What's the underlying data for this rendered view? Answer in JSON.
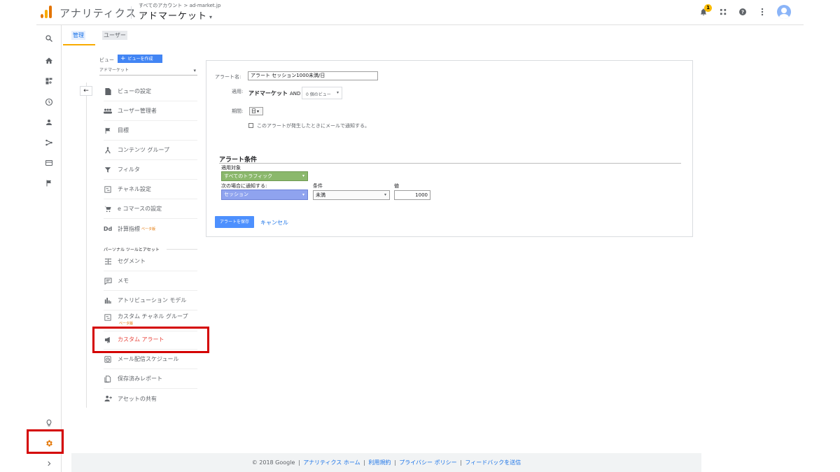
{
  "header": {
    "app_name": "アナリティクス",
    "breadcrumb_all": "すべてのアカウント",
    "breadcrumb_sep": ">",
    "breadcrumb_account": "ad-market.jp",
    "property_name": "アドマーケット",
    "notification_count": "1"
  },
  "tabs": [
    {
      "label": "管理"
    },
    {
      "label": "ユーザー"
    }
  ],
  "nav": {
    "view_label": "ビュー",
    "create_view_label": "ビューを作成",
    "selected_view": "アドマーケット",
    "items": [
      {
        "label": "ビューの設定",
        "icon": "document-icon"
      },
      {
        "label": "ユーザー管理者",
        "icon": "users-icon"
      },
      {
        "label": "目標",
        "icon": "flag-icon"
      },
      {
        "label": "コンテンツ グループ",
        "icon": "content-group-icon"
      },
      {
        "label": "フィルタ",
        "icon": "filter-icon"
      },
      {
        "label": "チャネル設定",
        "icon": "channel-icon"
      },
      {
        "label": "e コマースの設定",
        "icon": "cart-icon"
      },
      {
        "label": "計算指標",
        "icon": "calculated-metric-icon",
        "beta": "ベータ版"
      }
    ],
    "personal_section_label": "パーソナル ツールとアセット",
    "personal_items": [
      {
        "label": "セグメント",
        "icon": "segment-icon"
      },
      {
        "label": "メモ",
        "icon": "annotation-icon"
      },
      {
        "label": "アトリビューション モデル",
        "icon": "bar-chart-icon"
      },
      {
        "label": "カスタム チャネル グループ",
        "icon": "channel-group-icon",
        "beta": "ベータ版"
      },
      {
        "label": "カスタム アラート",
        "icon": "megaphone-icon"
      },
      {
        "label": "メール配信スケジュール",
        "icon": "alarm-icon"
      },
      {
        "label": "保存済みレポート",
        "icon": "saved-report-icon"
      },
      {
        "label": "アセットの共有",
        "icon": "share-person-icon"
      }
    ]
  },
  "form": {
    "name_label": "アラート名:",
    "name_value": "アラート セッション1000未満/日",
    "apply_label": "適用:",
    "apply_property": "アドマーケット",
    "apply_and": "AND",
    "views_dropdown": "0 個のビュー",
    "period_label": "期間:",
    "period_value": "日",
    "email_checkbox_label": "このアラートが発生したときにメールで通知する。",
    "conditions_heading": "アラート条件",
    "applies_to_label": "適用対象",
    "applies_to_value": "すべてのトラフィック",
    "notify_when_label": "次の場合に通知する:",
    "metric_value": "セッション",
    "condition_label": "条件",
    "condition_value": "未満",
    "value_label": "値",
    "value_value": "1000",
    "save_label": "アラートを保存",
    "cancel_label": "キャンセル"
  },
  "footer": {
    "copyright": "© 2018 Google",
    "links": [
      "アナリティクス ホーム",
      "利用規約",
      "プライバシー ポリシー",
      "フィードバックを送信"
    ],
    "separator": "|"
  },
  "colors": {
    "accent": "#1a73e8",
    "analytics_orange": "#e37400",
    "highlight_red": "#d40000",
    "active_red": "#e8453c",
    "green_dropdown": "#8bb86c",
    "blue_dropdown": "#8fa3ef"
  }
}
